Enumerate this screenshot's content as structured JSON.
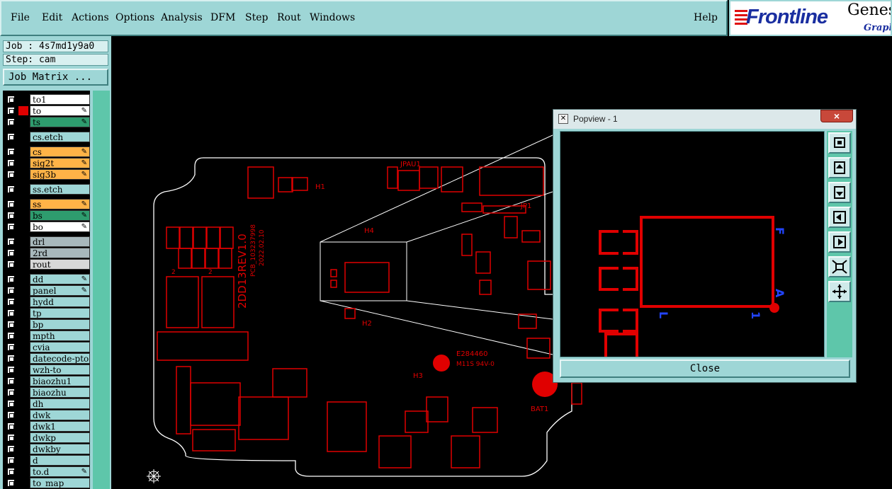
{
  "menu": {
    "items": [
      "File",
      "Edit",
      "Actions",
      "Options",
      "Analysis",
      "DFM",
      "Step",
      "Rout",
      "Windows"
    ],
    "help": "Help"
  },
  "logo": {
    "brand": "Frontline",
    "product": "Genes",
    "sub": "Graph"
  },
  "job": {
    "job_line": "Job : 4s7md1y9a0",
    "step_line": "Step: cam",
    "matrix_button": "Job Matrix ..."
  },
  "layers": [
    {
      "name": "to1",
      "bg": "#ffffff",
      "swatch": "#000000",
      "edit": false
    },
    {
      "name": "to",
      "bg": "#ffffff",
      "swatch": "#e00000",
      "edit": true
    },
    {
      "name": "ts",
      "bg": "#2e9c6e",
      "swatch": "#000000",
      "edit": true
    },
    {
      "name": "cs.etch",
      "bg": "#9ed6d6",
      "swatch": "#000000",
      "edit": false
    },
    {
      "name": "cs",
      "bg": "#ffb347",
      "swatch": "#000000",
      "edit": true
    },
    {
      "name": "sig2t",
      "bg": "#ffb347",
      "swatch": "#000000",
      "edit": true
    },
    {
      "name": "sig3b",
      "bg": "#ffb347",
      "swatch": "#000000",
      "edit": true
    },
    {
      "name": "ss.etch",
      "bg": "#9ed6d6",
      "swatch": "#000000",
      "edit": false
    },
    {
      "name": "ss",
      "bg": "#ffb347",
      "swatch": "#000000",
      "edit": true
    },
    {
      "name": "bs",
      "bg": "#2e9c6e",
      "swatch": "#000000",
      "edit": true
    },
    {
      "name": "bo",
      "bg": "#ffffff",
      "swatch": "#000000",
      "edit": true
    },
    {
      "name": "drl",
      "bg": "#a8b8bc",
      "swatch": "#000000",
      "edit": false
    },
    {
      "name": "2rd",
      "bg": "#a8b8bc",
      "swatch": "#000000",
      "edit": false
    },
    {
      "name": "rout",
      "bg": "#d8d8d8",
      "swatch": "#000000",
      "edit": false
    },
    {
      "name": "dd",
      "bg": "#9ed6d6",
      "swatch": "#000000",
      "edit": true
    },
    {
      "name": "panel",
      "bg": "#9ed6d6",
      "swatch": "#000000",
      "edit": true
    },
    {
      "name": "hydd",
      "bg": "#9ed6d6",
      "swatch": "#000000",
      "edit": false
    },
    {
      "name": "tp",
      "bg": "#9ed6d6",
      "swatch": "#000000",
      "edit": false
    },
    {
      "name": "bp",
      "bg": "#9ed6d6",
      "swatch": "#000000",
      "edit": false
    },
    {
      "name": "mpth",
      "bg": "#9ed6d6",
      "swatch": "#000000",
      "edit": false
    },
    {
      "name": "cvia",
      "bg": "#9ed6d6",
      "swatch": "#000000",
      "edit": false
    },
    {
      "name": "datecode-pto",
      "bg": "#9ed6d6",
      "swatch": "#000000",
      "edit": false
    },
    {
      "name": "wzh-to",
      "bg": "#9ed6d6",
      "swatch": "#000000",
      "edit": false
    },
    {
      "name": "biaozhu1",
      "bg": "#9ed6d6",
      "swatch": "#000000",
      "edit": false
    },
    {
      "name": "biaozhu",
      "bg": "#9ed6d6",
      "swatch": "#000000",
      "edit": false
    },
    {
      "name": "dh",
      "bg": "#9ed6d6",
      "swatch": "#000000",
      "edit": false
    },
    {
      "name": "dwk",
      "bg": "#9ed6d6",
      "swatch": "#000000",
      "edit": false
    },
    {
      "name": "dwk1",
      "bg": "#9ed6d6",
      "swatch": "#000000",
      "edit": false
    },
    {
      "name": "dwkp",
      "bg": "#9ed6d6",
      "swatch": "#000000",
      "edit": false
    },
    {
      "name": "dwkby",
      "bg": "#9ed6d6",
      "swatch": "#000000",
      "edit": false
    },
    {
      "name": "d",
      "bg": "#9ed6d6",
      "swatch": "#000000",
      "edit": false
    },
    {
      "name": "to.d",
      "bg": "#9ed6d6",
      "swatch": "#000000",
      "edit": true
    },
    {
      "name": "to_map",
      "bg": "#9ed6d6",
      "swatch": "#000000",
      "edit": false
    }
  ],
  "board_labels": {
    "jpau1": "JPAU1",
    "h1": "H1",
    "h4": "H4",
    "h2": "H2",
    "h3": "H3",
    "jp1": "JP1",
    "rev": "2DD13REV1.0",
    "pcb": "PCB_103237998",
    "date": "2022.02.10",
    "ul1": "E284460",
    "ul2": "M11S 94V-0",
    "bat": "BAT1",
    "n2a": "2",
    "n2b": "2"
  },
  "popview": {
    "title": "Popview - 1",
    "close_label": "Close",
    "close_x": "×",
    "labels": {
      "f": "F",
      "a": "A",
      "l": "L",
      "one": "1"
    },
    "tools": [
      "zoom-fit-icon",
      "pan-up-icon",
      "pan-down-icon",
      "pan-left-icon",
      "pan-right-icon",
      "zoom-in-icon",
      "zoom-out-icon"
    ]
  },
  "colors": {
    "panel": "#9ed6d6",
    "copper": "#e00000",
    "outline": "#ffffff",
    "label_blue": "#2244ff"
  }
}
